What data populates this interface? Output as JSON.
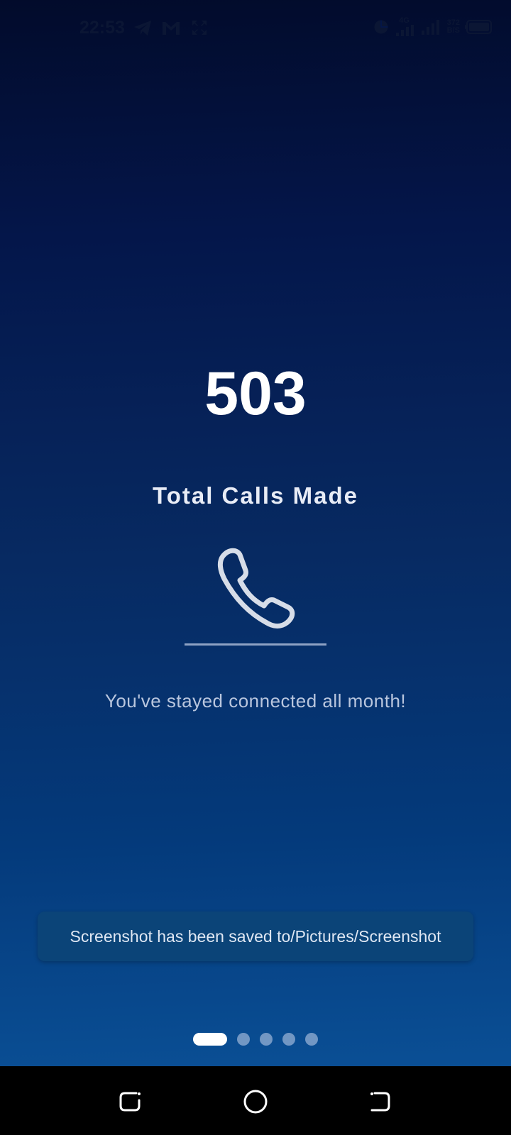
{
  "status_bar": {
    "time": "22:53",
    "icons_left": [
      "telegram-icon",
      "gmail-icon",
      "expand-icon"
    ],
    "network_type": "4G",
    "data_speed_value": "372",
    "data_speed_unit": "B/S",
    "icons_right": [
      "data-saver-icon",
      "signal-icon",
      "signal-icon",
      "battery-icon"
    ]
  },
  "stat": {
    "value": "503",
    "label": "Total Calls Made",
    "icon": "phone-icon",
    "message": "You've stayed connected all month!"
  },
  "toast": {
    "text": "Screenshot has been saved to/Pictures/Screenshot"
  },
  "pager": {
    "total_pages": 5,
    "current_page": 1
  },
  "navigation": {
    "buttons": [
      "recents-button",
      "home-button",
      "back-button"
    ]
  },
  "colors": {
    "background_top": "#020b2b",
    "background_bottom": "#0a4f95",
    "toast_background": "#0b4478",
    "text_primary": "#ffffff",
    "text_secondary": "#b9c6de"
  }
}
